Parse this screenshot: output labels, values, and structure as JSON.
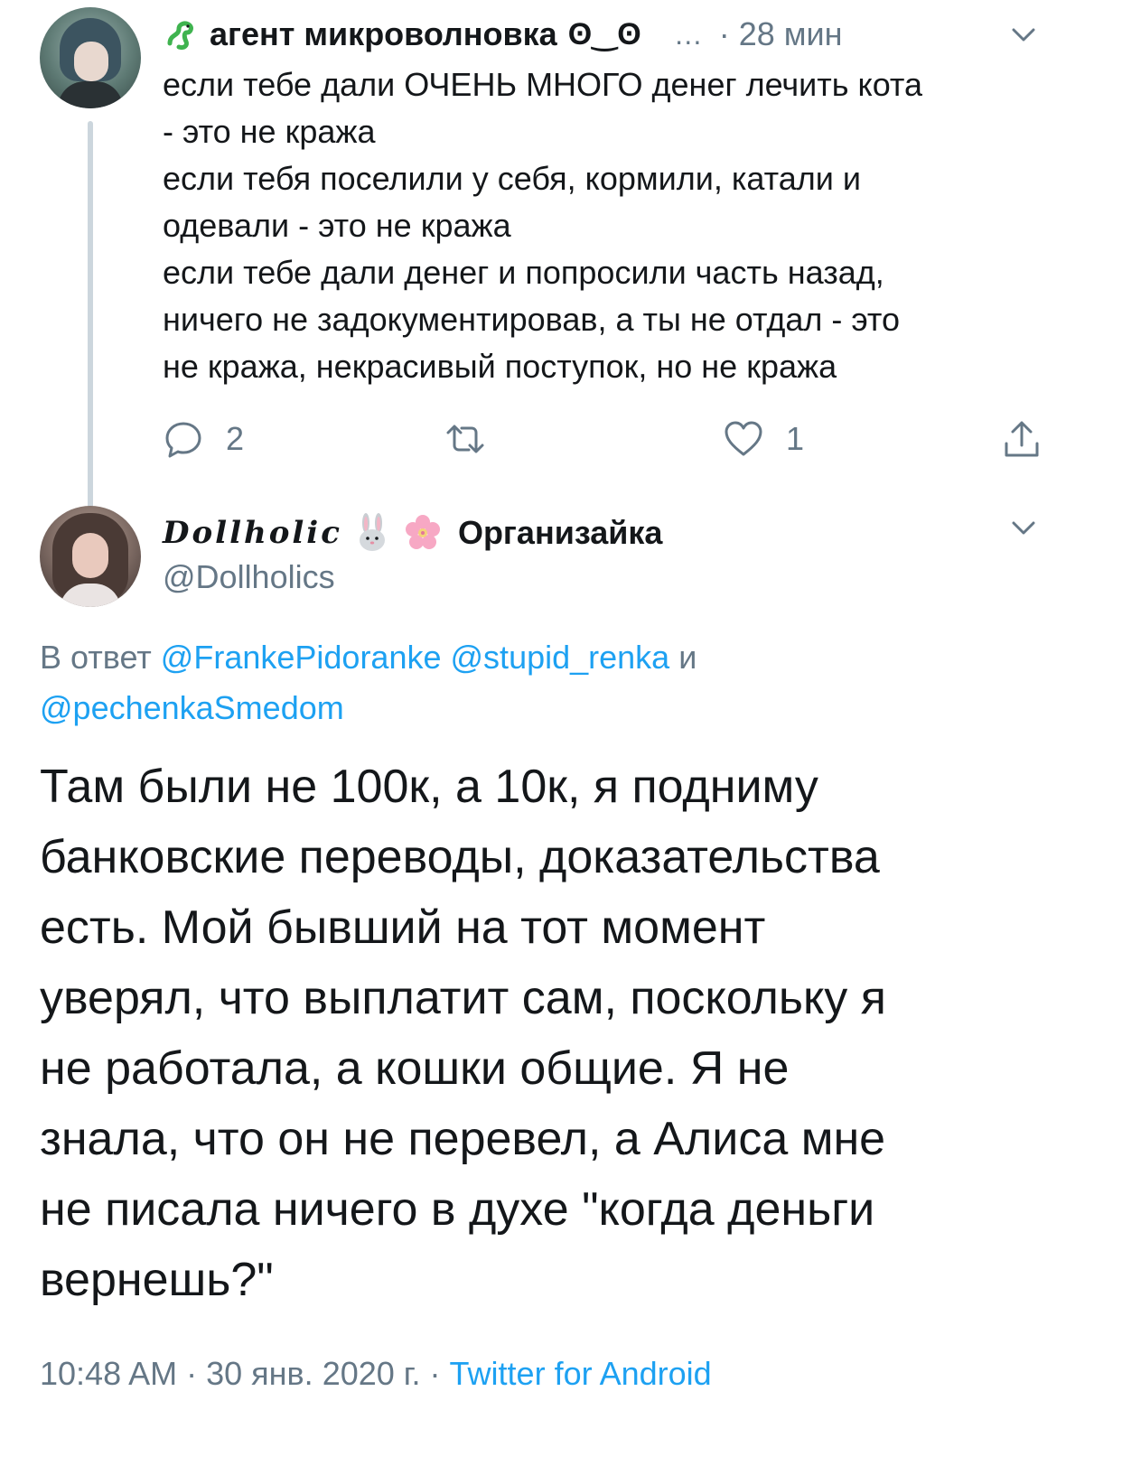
{
  "tweet1": {
    "author_name": "агент микроволновка",
    "author_deco": "ʘ‿ʘ",
    "menu_ellipsis": "…",
    "time": "· 28 мин",
    "text_lines": [
      "если тебе дали ОЧЕНЬ МНОГО денег лечить кота",
      "- это не кража",
      "если тебя поселили у себя, кормили, катали и",
      "одевали - это не кража",
      "если тебе дали денег и попросили часть назад,",
      "ничего не задокументировав, а ты не отдал - это",
      "не кража, некрасивый поступок, но не кража"
    ],
    "reply_count": "2",
    "like_count": "1"
  },
  "tweet2": {
    "display_script": "Dollholic",
    "display_suffix": "Организайка",
    "handle": "@Dollholics",
    "reply_prefix": "В ответ",
    "mentions": [
      "@FrankePidoranke",
      "@stupid_renka",
      "@pechenkaSmedom"
    ],
    "reply_joiner": "и",
    "text_lines": [
      "Там были не 100к,  а 10к,  я подниму",
      "банковские переводы,  доказательства",
      "есть. Мой бывший на тот момент",
      "уверял, что выплатит сам, поскольку я",
      "не работала, а кошки общие. Я не",
      "знала, что он не перевел,  а Алиса мне",
      "не писала ничего в духе \"когда деньги",
      "вернешь?\""
    ],
    "time": "10:48 AM",
    "date": "30 янв. 2020 г.",
    "separator": "·",
    "source": "Twitter for Android"
  },
  "colors": {
    "accent": "#1da1f2",
    "secondary_text": "#657786",
    "thread_line": "#ccd6dd"
  },
  "icons": [
    "snake-icon",
    "chevron-down-icon",
    "reply-icon",
    "retweet-icon",
    "like-icon",
    "share-icon",
    "rabbit-icon",
    "blossom-icon"
  ]
}
